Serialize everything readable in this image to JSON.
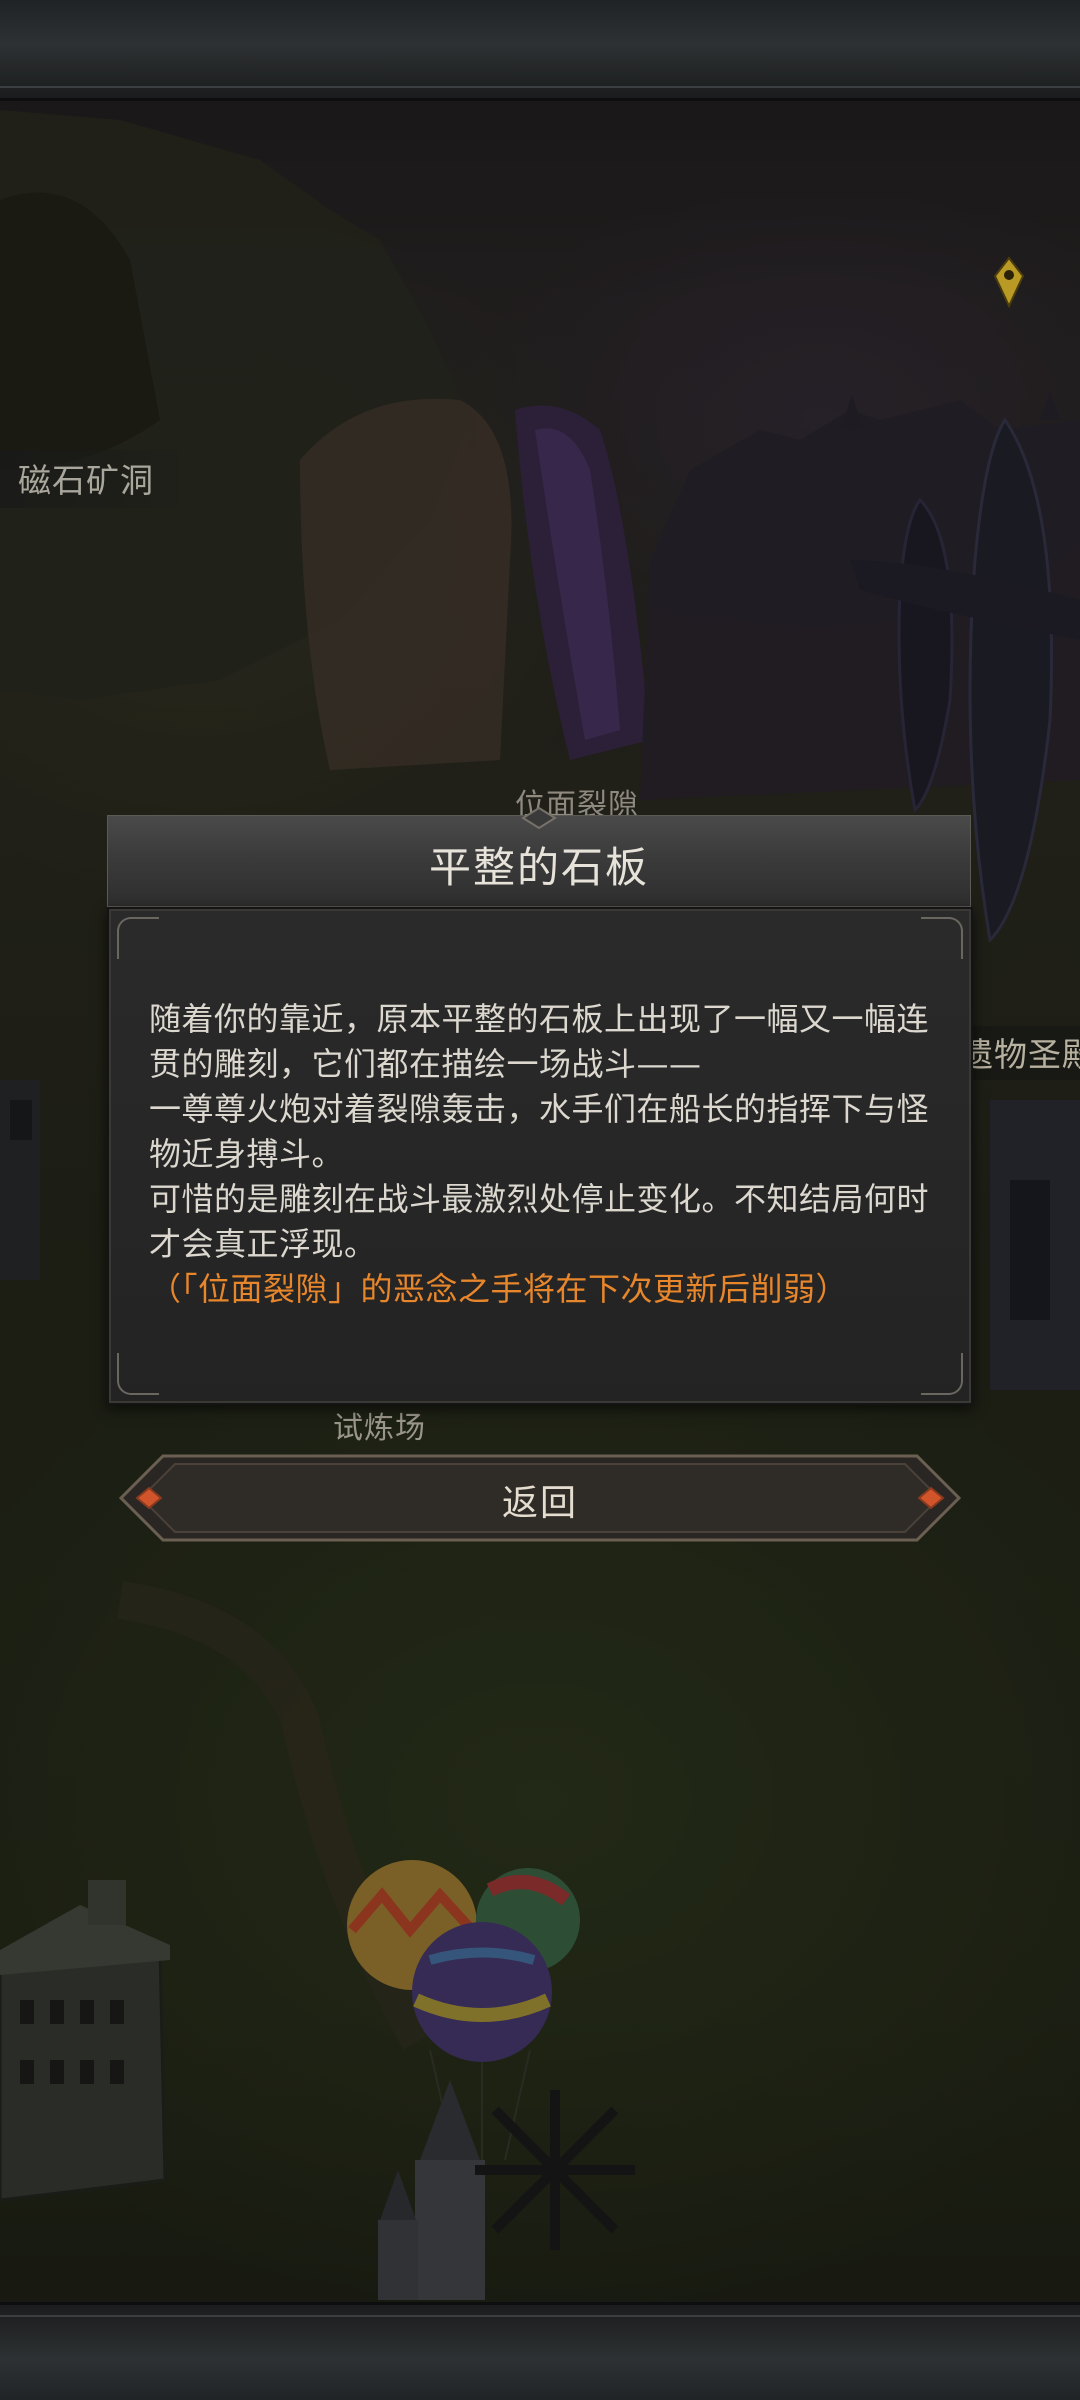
{
  "map": {
    "labels": {
      "cishi_kuangdong": "磁石矿洞",
      "weimian_liexi": "位面裂隙",
      "shilianchang": "试炼场",
      "shengdian_partial": "遗物圣殿"
    }
  },
  "dialog": {
    "title": "平整的石板",
    "paragraphs": [
      "随着你的靠近，原本平整的石板上出现了一幅又一幅连贯的雕刻，它们都在描绘一场战斗——",
      "一尊尊火炮对着裂隙轰击，水手们在船长的指挥下与怪物近身搏斗。",
      "可惜的是雕刻在战斗最激烈处停止变化。不知结局何时才会真正浮现。"
    ],
    "notice": "（「位面裂隙」的恶念之手将在下次更新后削弱）"
  },
  "buttons": {
    "return_label": "返回"
  },
  "colors": {
    "notice_orange": "#e8862b",
    "body_text": "#dcd8cf",
    "button_accent": "#d2542a"
  },
  "icons": [
    "map-pin-icon",
    "diamond-ornament-icon"
  ]
}
